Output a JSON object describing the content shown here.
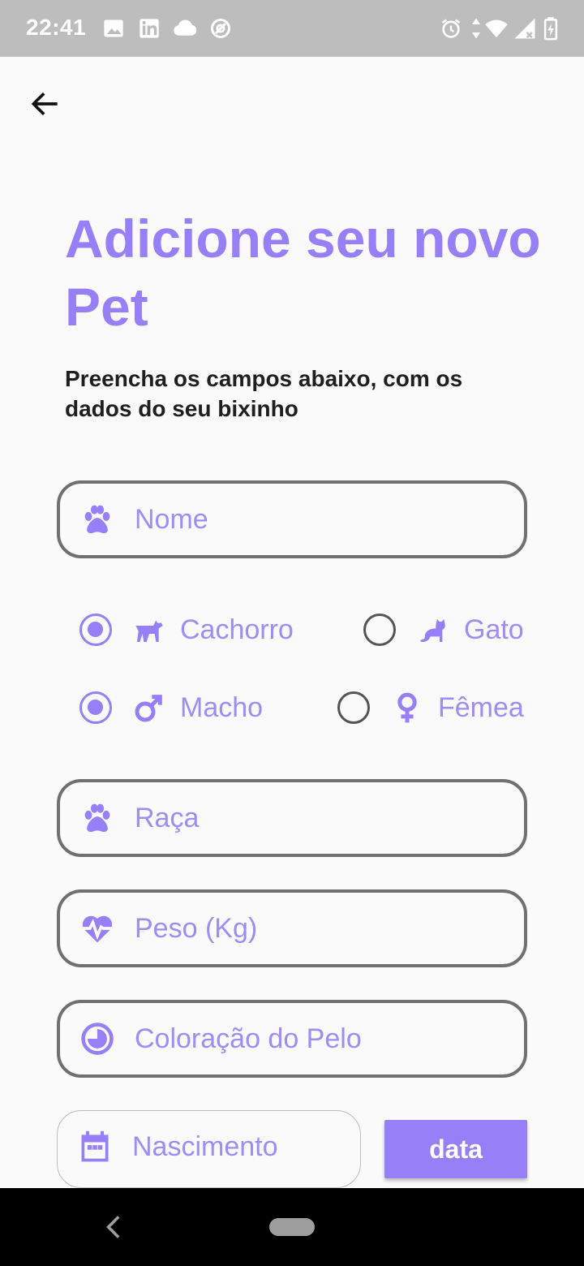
{
  "status_bar": {
    "time": "22:41",
    "left_icons": [
      "image-icon",
      "linkedin-icon",
      "cloud-icon",
      "at-sign-icon"
    ],
    "right_icons": [
      "alarm-icon",
      "data-arrows-icon",
      "wifi-icon",
      "signal-icon",
      "battery-icon"
    ]
  },
  "header": {
    "back_icon": "arrow-left-icon",
    "title": "Adicione seu novo Pet",
    "subtitle": "Preencha os campos abaixo, com os dados do seu bixinho"
  },
  "form": {
    "name": {
      "placeholder": "Nome",
      "value": "",
      "icon": "paw-icon"
    },
    "species": {
      "options": [
        {
          "label": "Cachorro",
          "icon": "dog-icon",
          "selected": true
        },
        {
          "label": "Gato",
          "icon": "cat-icon",
          "selected": false
        }
      ]
    },
    "sex": {
      "options": [
        {
          "label": "Macho",
          "icon": "male-symbol-icon",
          "selected": true
        },
        {
          "label": "Fêmea",
          "icon": "female-symbol-icon",
          "selected": false
        }
      ]
    },
    "breed": {
      "placeholder": "Raça",
      "value": "",
      "icon": "paw-icon"
    },
    "weight": {
      "placeholder": "Peso (Kg)",
      "value": "",
      "icon": "heartbeat-icon"
    },
    "fur_color": {
      "placeholder": "Coloração do Pelo",
      "value": "",
      "icon": "color-circle-icon"
    },
    "birth": {
      "placeholder": "Nascimento",
      "value": "",
      "icon": "calendar-icon"
    },
    "date_button": "data"
  },
  "colors": {
    "accent": "#9580f7",
    "placeholder": "#9e8df5",
    "border": "#707070",
    "status_bar": "#bdbdbd"
  }
}
